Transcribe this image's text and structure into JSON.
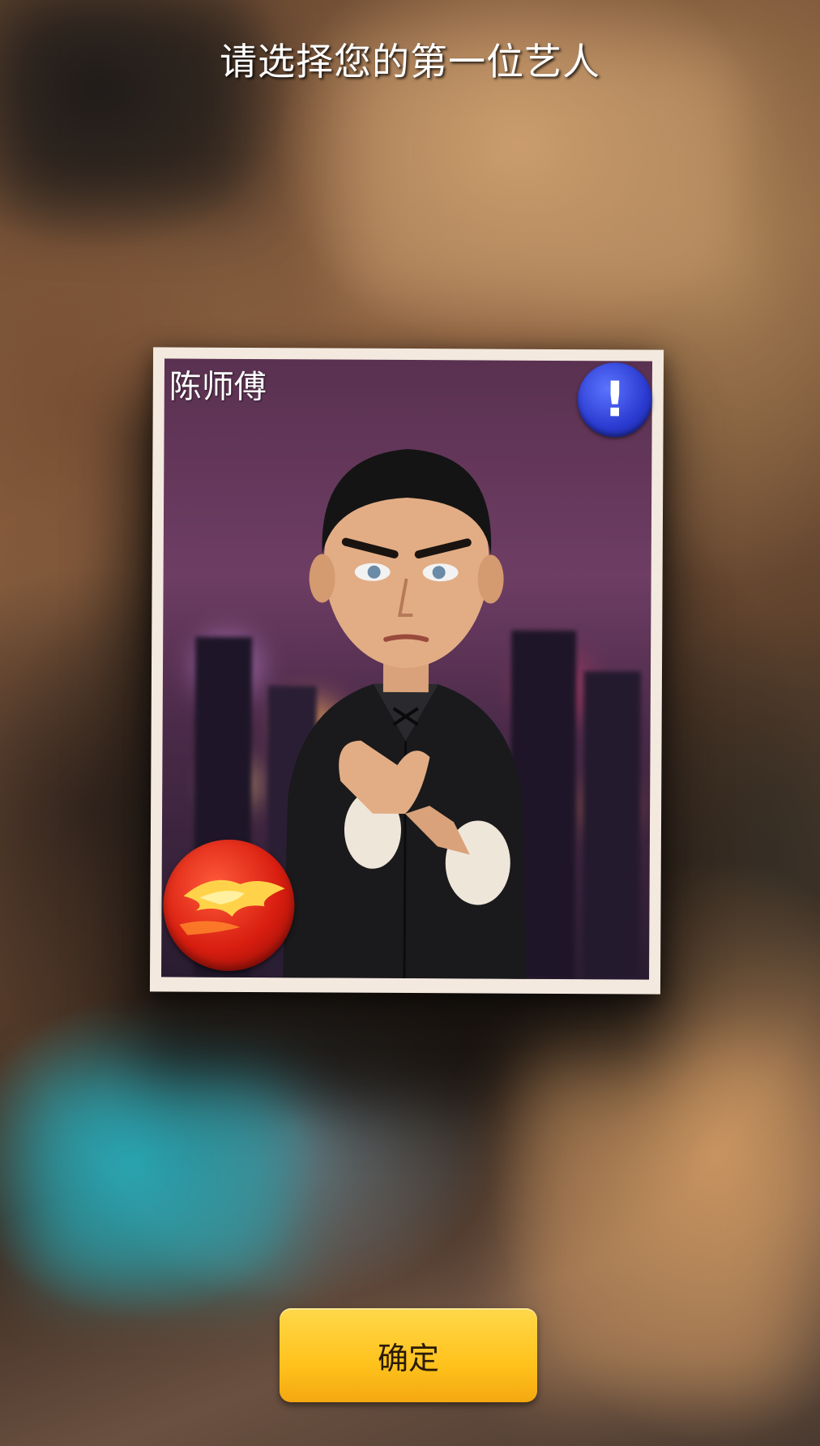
{
  "header": {
    "title": "请选择您的第一位艺人"
  },
  "card": {
    "artist_name": "陈师傅",
    "info_icon": "exclamation-icon",
    "info_symbol": "!",
    "badge_icon": "red-star-orb-icon"
  },
  "footer": {
    "confirm_label": "确定"
  },
  "colors": {
    "confirm_button": "#ffc21c",
    "info_button": "#2a3ad0",
    "badge": "#d81e10",
    "card_frame": "#f3e9df"
  }
}
